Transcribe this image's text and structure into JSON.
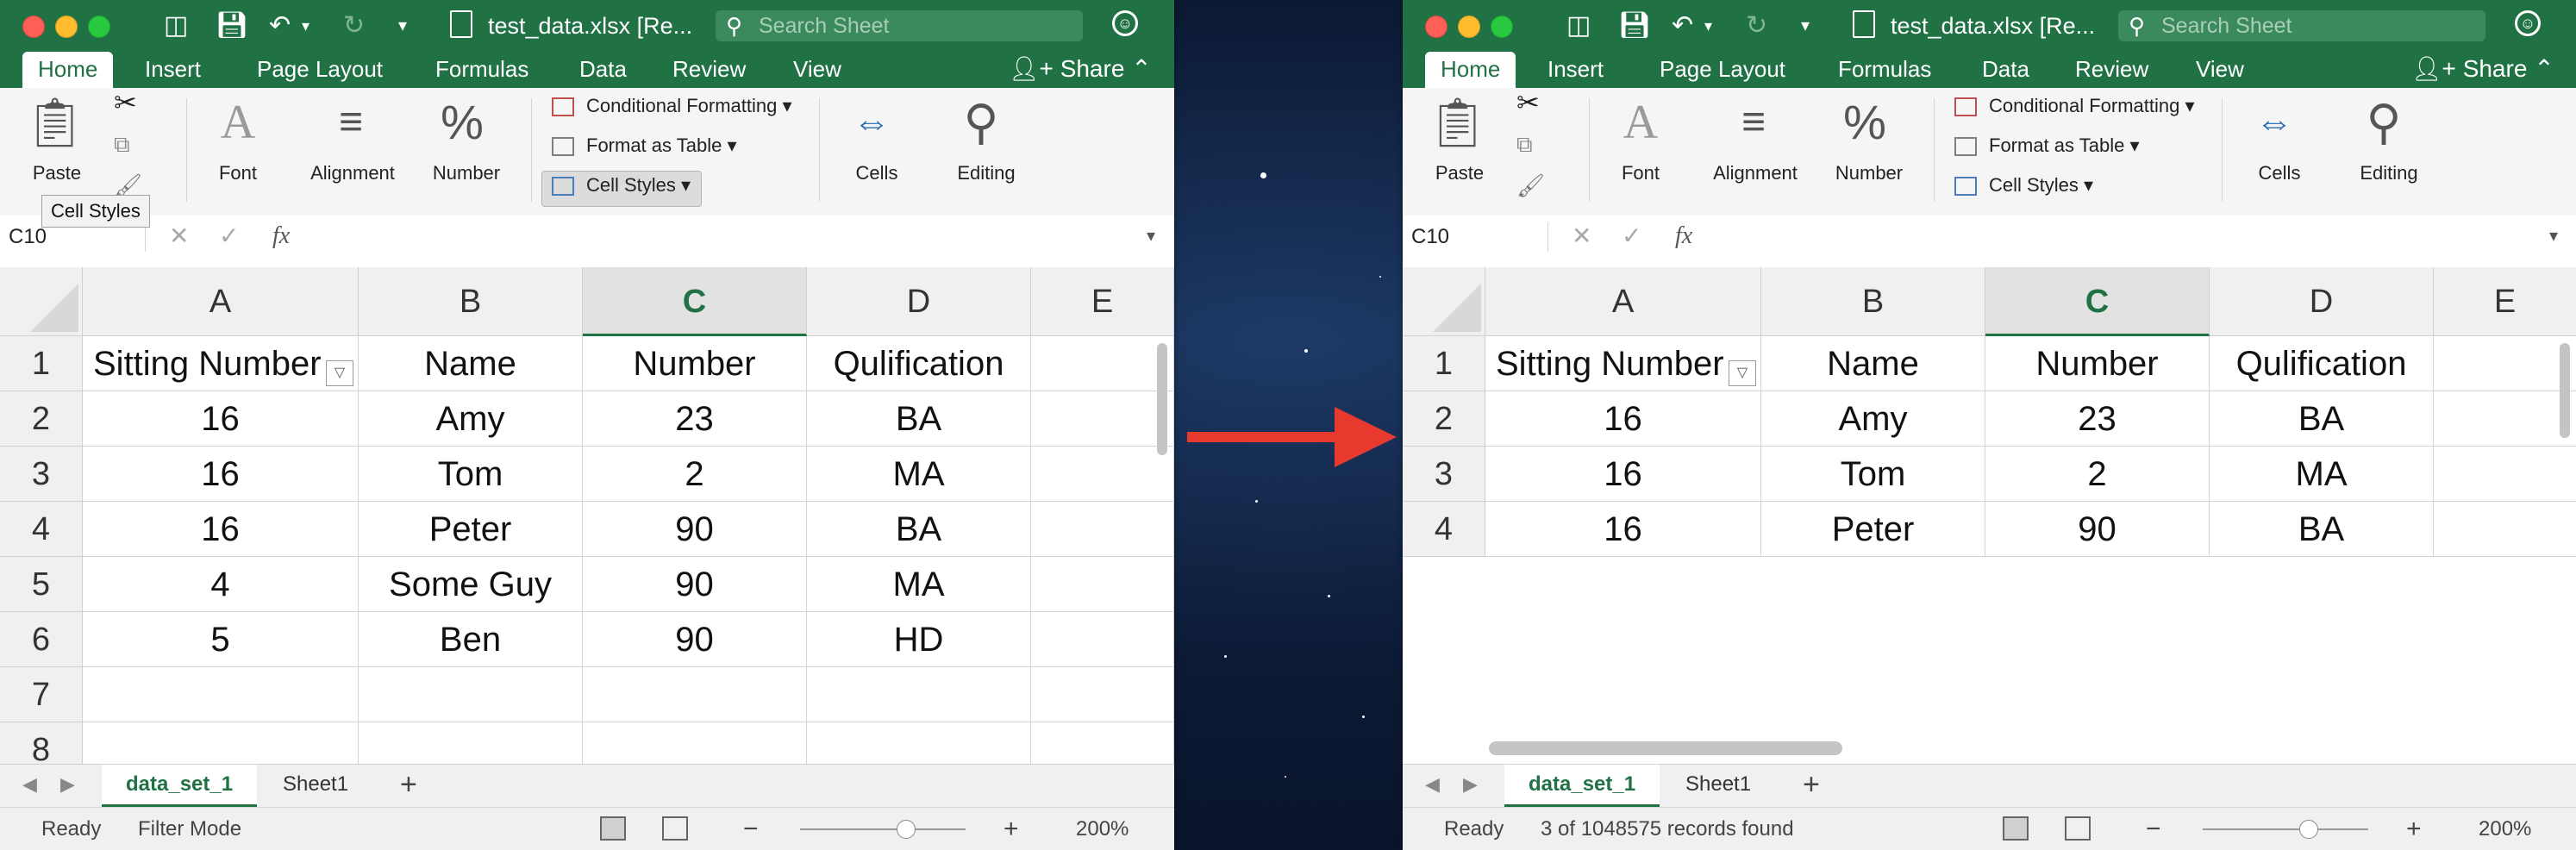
{
  "windows": [
    {
      "id": "left",
      "title": "test_data.xlsx [Re...",
      "search_placeholder": "Search Sheet",
      "tabs": [
        "Home",
        "Insert",
        "Page Layout",
        "Formulas",
        "Data",
        "Review",
        "View"
      ],
      "active_tab": "Home",
      "share_label": "Share",
      "ribbon": {
        "paste": "Paste",
        "font": "Font",
        "alignment": "Alignment",
        "number": "Number",
        "conditional_formatting": "Conditional Formatting",
        "format_as_table": "Format as Table",
        "cell_styles": "Cell Styles",
        "cells": "Cells",
        "editing": "Editing"
      },
      "tooltip": "Cell Styles",
      "name_box": "C10",
      "fx_label": "fx",
      "columns": [
        "A",
        "B",
        "C",
        "D",
        "E"
      ],
      "selected_column": "C",
      "rows": [
        {
          "num": "1",
          "cells": [
            "Sitting Number",
            "Name",
            "Number",
            "Qulification"
          ]
        },
        {
          "num": "2",
          "cells": [
            "16",
            "Amy",
            "23",
            "BA"
          ]
        },
        {
          "num": "3",
          "cells": [
            "16",
            "Tom",
            "2",
            "MA"
          ]
        },
        {
          "num": "4",
          "cells": [
            "16",
            "Peter",
            "90",
            "BA"
          ]
        },
        {
          "num": "5",
          "cells": [
            "4",
            "Some Guy",
            "90",
            "MA"
          ]
        },
        {
          "num": "6",
          "cells": [
            "5",
            "Ben",
            "90",
            "HD"
          ]
        },
        {
          "num": "7",
          "cells": [
            "",
            "",
            "",
            ""
          ]
        },
        {
          "num": "8",
          "cells": [
            "",
            "",
            "",
            ""
          ]
        }
      ],
      "sheet_tabs": [
        "data_set_1",
        "Sheet1"
      ],
      "active_sheet": "data_set_1",
      "status_ready": "Ready",
      "status_info": "Filter Mode",
      "zoom": "200%"
    },
    {
      "id": "right",
      "title": "test_data.xlsx [Re...",
      "search_placeholder": "Search Sheet",
      "tabs": [
        "Home",
        "Insert",
        "Page Layout",
        "Formulas",
        "Data",
        "Review",
        "View"
      ],
      "active_tab": "Home",
      "share_label": "Share",
      "ribbon": {
        "paste": "Paste",
        "font": "Font",
        "alignment": "Alignment",
        "number": "Number",
        "conditional_formatting": "Conditional Formatting",
        "format_as_table": "Format as Table",
        "cell_styles": "Cell Styles",
        "cells": "Cells",
        "editing": "Editing"
      },
      "tooltip": "",
      "name_box": "C10",
      "fx_label": "fx",
      "columns": [
        "A",
        "B",
        "C",
        "D",
        "E"
      ],
      "selected_column": "C",
      "rows": [
        {
          "num": "1",
          "cells": [
            "Sitting Number",
            "Name",
            "Number",
            "Qulification"
          ]
        },
        {
          "num": "2",
          "cells": [
            "16",
            "Amy",
            "23",
            "BA"
          ]
        },
        {
          "num": "3",
          "cells": [
            "16",
            "Tom",
            "2",
            "MA"
          ]
        },
        {
          "num": "4",
          "cells": [
            "16",
            "Peter",
            "90",
            "BA"
          ]
        }
      ],
      "sheet_tabs": [
        "data_set_1",
        "Sheet1"
      ],
      "active_sheet": "data_set_1",
      "status_ready": "Ready",
      "status_info": "3 of 1048575 records found",
      "zoom": "200%"
    }
  ],
  "colors": {
    "excel_green": "#207245",
    "arrow_red": "#e8392f",
    "background": "#0c1a35"
  }
}
